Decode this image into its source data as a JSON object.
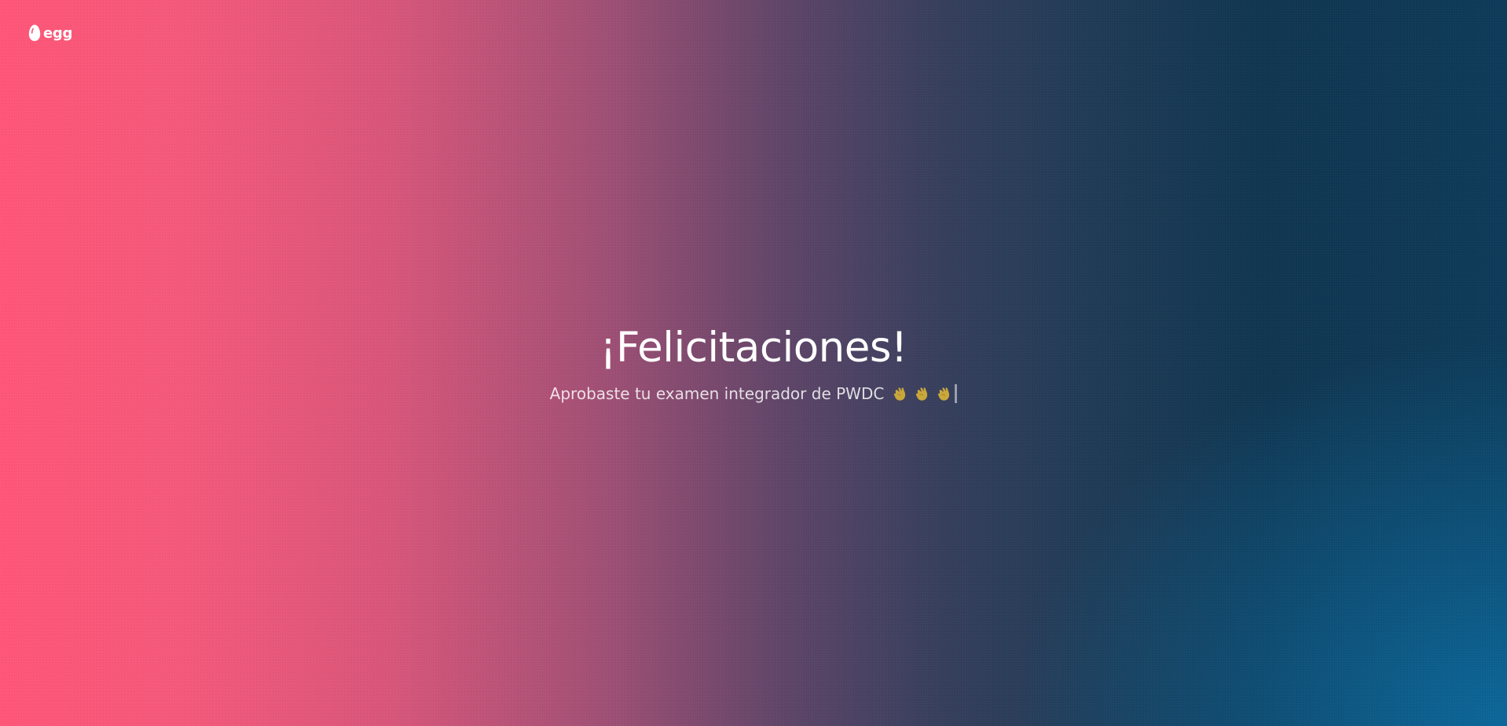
{
  "logo": {
    "text": "egg"
  },
  "main": {
    "title": "¡Felicitaciones!",
    "subtitle": "Aprobaste tu examen integrador de PWDC"
  },
  "icons": {
    "logo": "egg-icon",
    "clap": "clapping-hands-icon",
    "clap_count": 3
  },
  "colors": {
    "gradient_left": "#ff5577",
    "gradient_middle": "#5e4468",
    "gradient_right": "#0c3a58",
    "gradient_bottom_right": "#0a6ea5",
    "clap_color": "#c9a73a",
    "text": "#ffffff"
  }
}
